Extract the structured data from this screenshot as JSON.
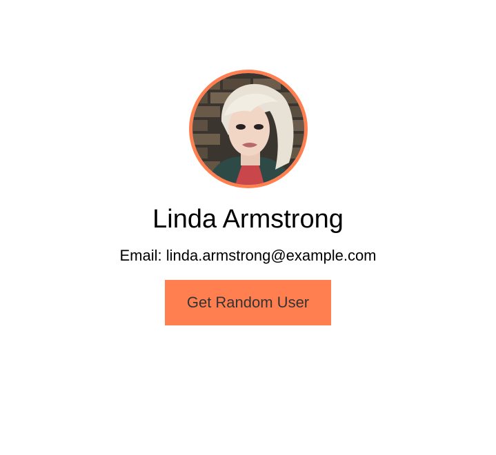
{
  "profile": {
    "name": "Linda Armstrong",
    "email_label": "Email:",
    "email": "linda.armstrong@example.com"
  },
  "actions": {
    "get_random_user_label": "Get Random User"
  },
  "colors": {
    "accent": "#ff7f50",
    "button_text": "#333333",
    "text": "#000000",
    "background": "#ffffff"
  },
  "icons": {
    "avatar": "user-photo"
  }
}
